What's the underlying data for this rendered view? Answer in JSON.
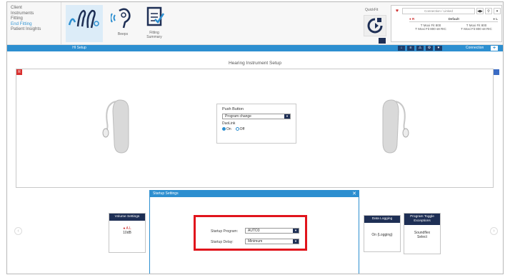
{
  "nav": {
    "items": [
      "Client",
      "Instruments",
      "Fitting",
      "End Fitting",
      "Patient Insights"
    ],
    "active_index": 3
  },
  "tools": {
    "beeps_label": "Beeps",
    "fitting_summary_label_line1": "Fitting",
    "fitting_summary_label_line2": "Summary"
  },
  "quickfit": {
    "label": "QuickFit"
  },
  "connection_panel": {
    "status_text": "Connection / Linked",
    "arrows": "◀▶",
    "hi_left": "● R",
    "hi_mid": "Default",
    "hi_right": "● L",
    "left_line1": "T Moxi Fit 800",
    "left_line2": "T Moxi Fit 800 s8 RIC",
    "right_line1": "T Moxi Fit 800",
    "right_line2": "T Moxi Fit 800 s8 RIC"
  },
  "bluebar": {
    "tab_label": "HI Setup",
    "connection_label": "Connection",
    "plus": "+",
    "icons": [
      "↓",
      "≡",
      "⚠",
      "⚙",
      "♥"
    ]
  },
  "main": {
    "title": "Hearing Instrument Setup",
    "red_marker": "R"
  },
  "push_button": {
    "title": "Push Button",
    "selection": "Program change",
    "duolink_label": "DuoLink",
    "on_label": "On",
    "off_label": "Off"
  },
  "cards": {
    "volume": {
      "title": "Volume Settings",
      "value_line1": "● A L",
      "value_line2": "10dB"
    },
    "data_logging": {
      "title": "Data Logging",
      "value": "On (Logging)"
    },
    "program_toggle": {
      "title_line1": "Program Toggle",
      "title_line2": "Exceptions",
      "value_line1": "Soundflex",
      "value_line2": "Select"
    }
  },
  "startup_modal": {
    "title": "Startup Settings",
    "close": "✕",
    "program_label": "Startup Program:",
    "program_value": "AUTO3",
    "delay_label": "Startup Delay:",
    "delay_value": "Minimum"
  },
  "colors": {
    "accent": "#2d8fd0",
    "navy": "#1e2f55",
    "highlight": "#e1141c"
  }
}
